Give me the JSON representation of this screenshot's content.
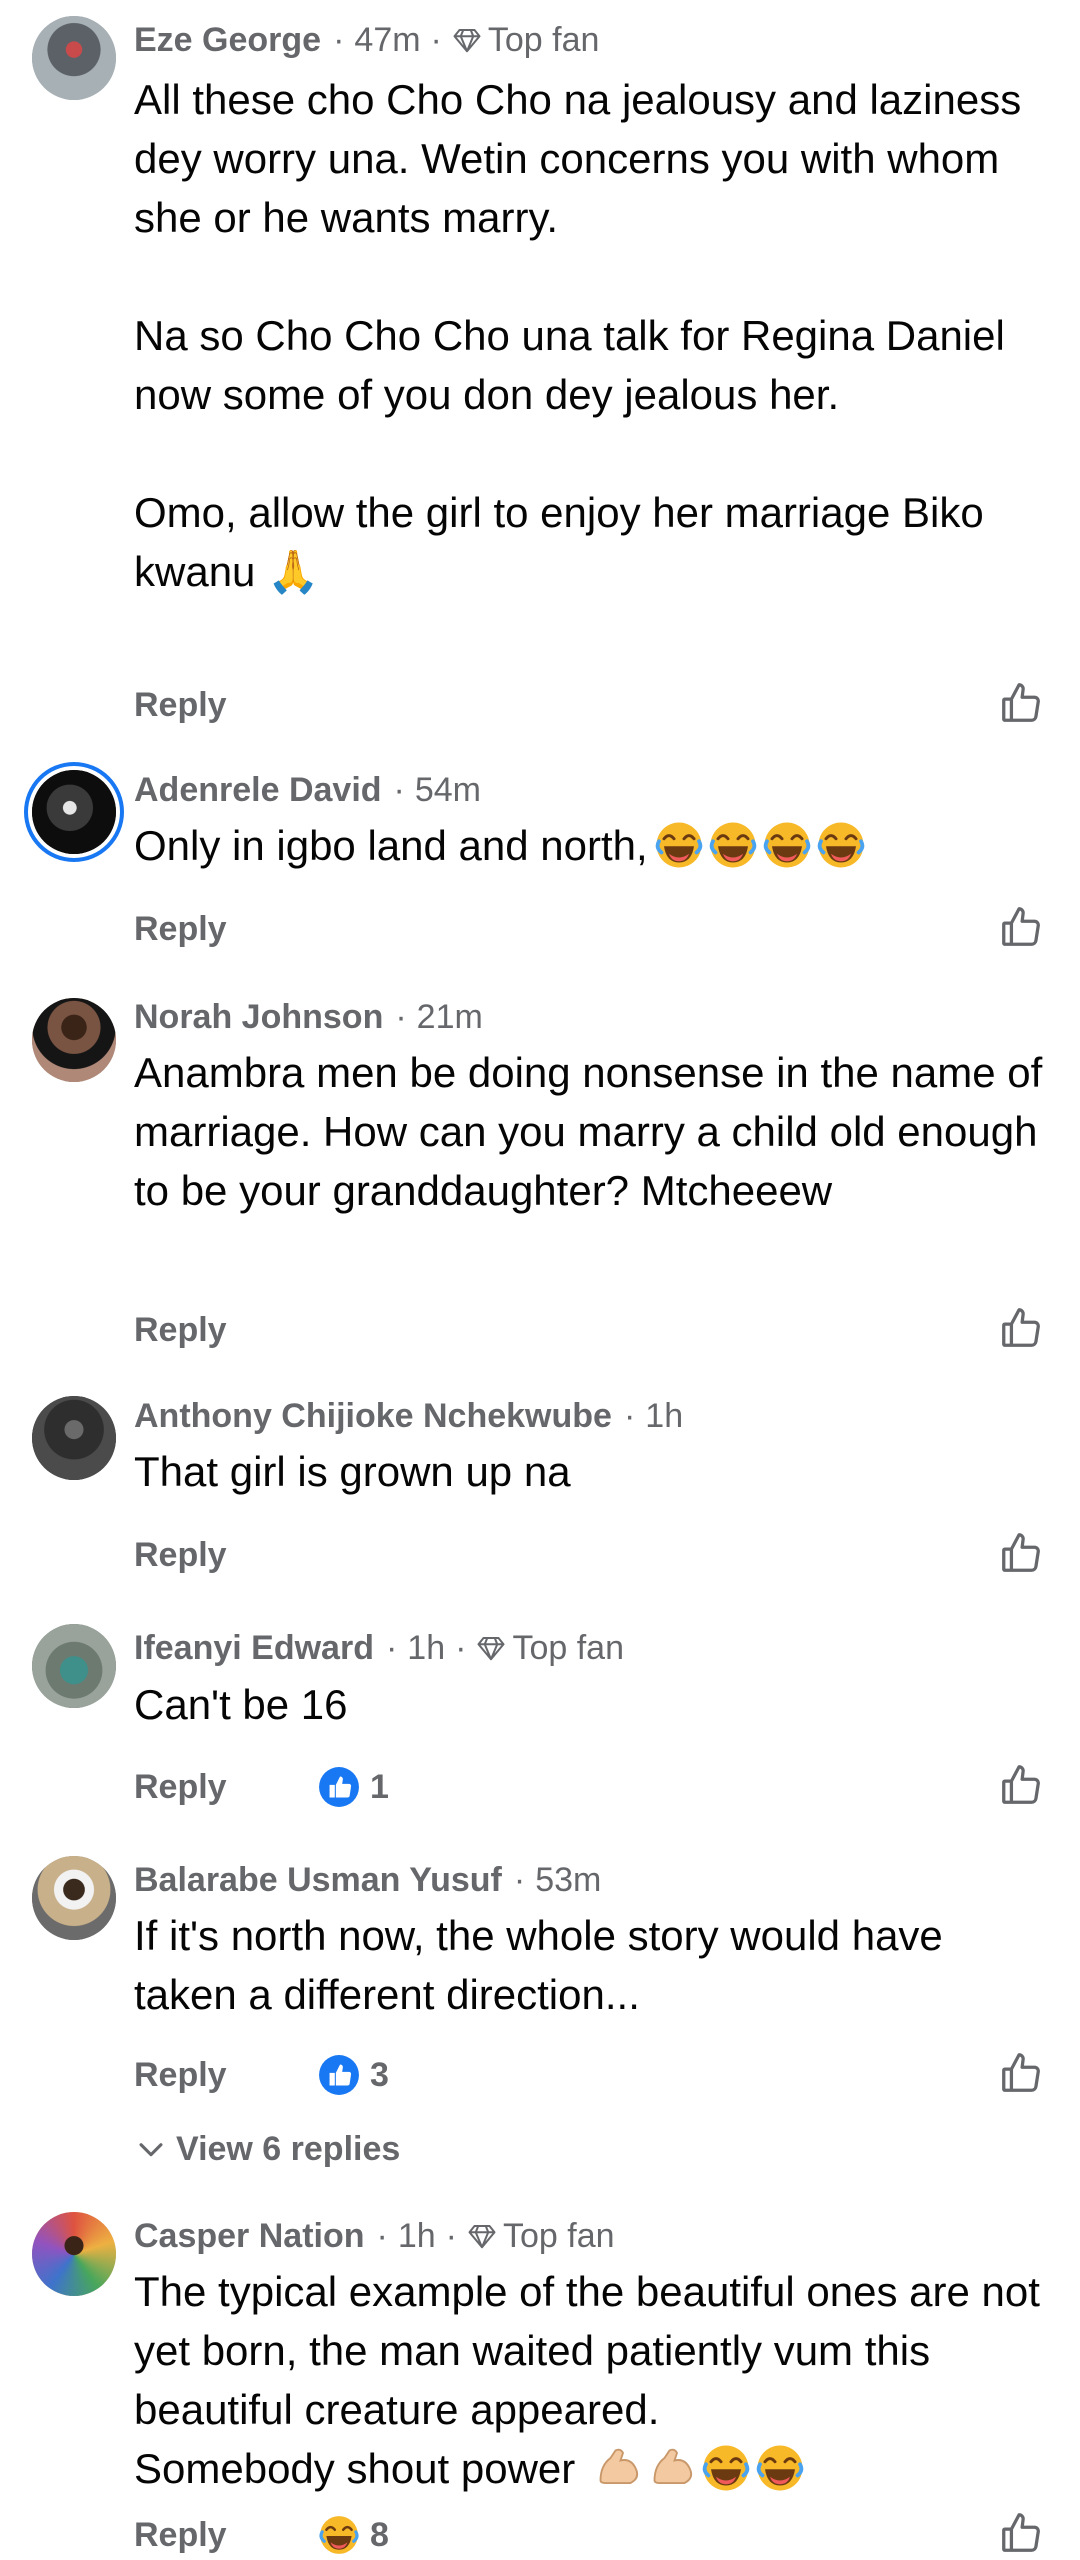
{
  "ui": {
    "reply_label": "Reply",
    "top_fan_label": "Top fan",
    "dot": "·"
  },
  "comments": [
    {
      "name": "Eze George",
      "time": "47m",
      "top_fan": true,
      "text": "All these cho Cho Cho na jealousy and laziness dey worry una. Wetin concerns you with whom  she or he wants marry.\n\nNa so Cho Cho Cho una talk for Regina Daniel now some of you don dey jealous her.\n\nOmo, allow the girl to enjoy her marriage Biko kwanu",
      "trailing_emoji": "🙏"
    },
    {
      "name": "Adenrele David",
      "time": "54m",
      "text": "Only in igbo land and north,"
    },
    {
      "name": "Norah Johnson",
      "time": "21m",
      "text": "Anambra men be doing nonsense in the name of marriage. How can you marry a child old enough to be your granddaughter? Mtcheeew"
    },
    {
      "name": "Anthony Chijioke Nchekwube",
      "time": "1h",
      "text": "That girl is grown up na"
    },
    {
      "name": "Ifeanyi Edward",
      "time": "1h",
      "top_fan": true,
      "text": "Can't be 16",
      "reaction_count": "1"
    },
    {
      "name": "Balarabe Usman Yusuf",
      "time": "53m",
      "text": "If it's north now, the whole story would have taken a different direction...",
      "reaction_count": "3",
      "view_replies": "View 6 replies"
    },
    {
      "name": "Casper Nation",
      "time": "1h",
      "top_fan": true,
      "text": "The typical example of the beautiful ones are not yet born, the man waited patiently vum this beautiful creature appeared.\nSomebody shout power",
      "reaction_count": "8"
    }
  ],
  "colors": {
    "meta": "#65676b",
    "text": "#050505",
    "like_blue": "#1877f2",
    "laugh_yellow": "#f7b928"
  }
}
